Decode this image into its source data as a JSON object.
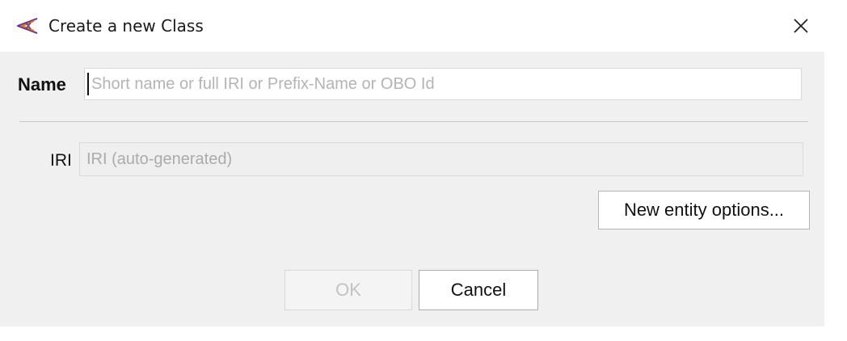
{
  "window": {
    "title": "Create a new Class",
    "app_icon": "protege-icon",
    "close_icon": "close-icon"
  },
  "form": {
    "name_label": "Name",
    "name_value": "",
    "name_placeholder": "Short name or full IRI or Prefix-Name or OBO Id",
    "iri_label": "IRI",
    "iri_value": "",
    "iri_placeholder": "IRI (auto-generated)"
  },
  "buttons": {
    "options_label": "New entity options...",
    "ok_label": "OK",
    "ok_enabled": false,
    "cancel_label": "Cancel"
  },
  "colors": {
    "panel_bg": "#f0f0f0",
    "icon_purple": "#6b3a8c",
    "icon_orange": "#e07b24"
  }
}
